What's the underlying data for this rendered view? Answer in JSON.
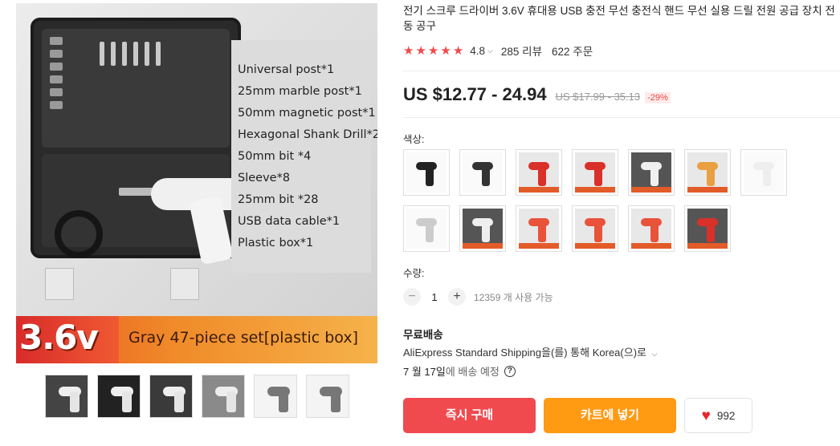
{
  "product": {
    "title": "전기 스크루 드라이버 3.6V 휴대용 USB 충전 무선 충전식 핸드 무선 실용 드릴 전원 공급 장치 전동 공구",
    "rating": "4.8",
    "reviews": "285 리뷰",
    "orders": "622 주문",
    "price": "US $12.77 - 24.94",
    "old_price": "US $17.99 - 35.13",
    "discount": "-29%"
  },
  "main_image": {
    "specs": [
      "Universal post*1",
      "25mm marble post*1",
      "50mm magnetic post*1",
      "Hexagonal Shank Drill*2",
      "50mm bit *4",
      "Sleeve*8",
      "25mm bit *28",
      "USB data cable*1",
      "Plastic box*1"
    ],
    "voltage_badge": "3.6v",
    "set_label": "Gray 47-piece set[plastic box]"
  },
  "thumbnails": [
    {
      "name": "thumb-1",
      "style": "dark"
    },
    {
      "name": "thumb-2",
      "style": "dark"
    },
    {
      "name": "thumb-3",
      "style": "dark"
    },
    {
      "name": "thumb-4",
      "style": "gray"
    },
    {
      "name": "thumb-5",
      "style": "light"
    },
    {
      "name": "thumb-6",
      "style": "light"
    }
  ],
  "color": {
    "label": "색상:",
    "swatches": [
      {
        "style": "white",
        "drill": "#222222"
      },
      {
        "style": "white",
        "drill": "#333333"
      },
      {
        "style": "light",
        "drill": "#d9302a"
      },
      {
        "style": "light",
        "drill": "#d9302a"
      },
      {
        "style": "dark",
        "drill": "#f0f0f0"
      },
      {
        "style": "light",
        "drill": "#e8a040"
      },
      {
        "style": "white",
        "drill": "#eeeeee"
      },
      {
        "style": "white",
        "drill": "#cccccc"
      },
      {
        "style": "dark",
        "drill": "#eeeeee"
      },
      {
        "style": "light",
        "drill": "#e8533a"
      },
      {
        "style": "light",
        "drill": "#e8533a"
      },
      {
        "style": "light",
        "drill": "#e8533a"
      },
      {
        "style": "dark",
        "drill": "#d9302a"
      }
    ]
  },
  "quantity": {
    "label": "수량:",
    "minus": "−",
    "value": "1",
    "plus": "+",
    "available": "12359 개 사용 가능"
  },
  "shipping": {
    "title": "무료배송",
    "method": "AliExpress Standard Shipping을(를) 통해 Korea(으)로",
    "delivery_date": "7 월 17일",
    "delivery_suffix": "에 배송 예정",
    "help": "?"
  },
  "actions": {
    "buy_now": "즉시 구매",
    "add_to_cart": "카트에 넣기",
    "wishlist_count": "992"
  },
  "colors": {
    "star": "#f04a4a",
    "buy": "#f04a4f",
    "cart": "#ff9a13",
    "heart": "#e8262d",
    "discount": "#f0463c"
  }
}
